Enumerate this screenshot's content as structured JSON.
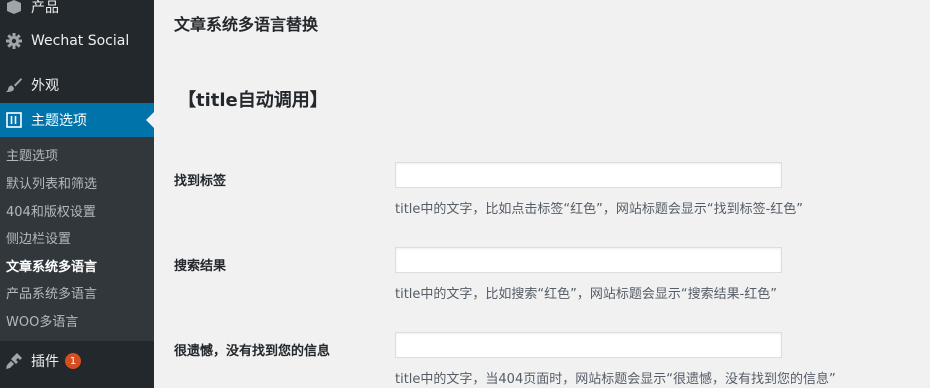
{
  "sidebar": {
    "top": [
      {
        "label": "产品",
        "icon": "archive-icon"
      },
      {
        "label": "Wechat Social",
        "icon": "gear-icon"
      },
      {
        "label": "外观",
        "icon": "paintbrush-icon"
      },
      {
        "label": "主题选项",
        "icon": "theme-options-icon",
        "current": true
      }
    ],
    "submenu": [
      {
        "label": "主题选项"
      },
      {
        "label": "默认列表和筛选"
      },
      {
        "label": "404和版权设置"
      },
      {
        "label": "侧边栏设置"
      },
      {
        "label": "文章系统多语言",
        "active": true
      },
      {
        "label": "产品系统多语言"
      },
      {
        "label": "WOO多语言"
      }
    ],
    "plugins": {
      "label": "插件",
      "badge": "1",
      "icon": "plugin-icon"
    }
  },
  "main": {
    "page_title": "文章系统多语言替换",
    "section_title": "【title自动调用】",
    "fields": [
      {
        "label": "找到标签",
        "value": "",
        "description": "title中的文字，比如点击标签“红色”，网站标题会显示“找到标签-红色”"
      },
      {
        "label": "搜索结果",
        "value": "",
        "description": "title中的文字，比如搜索“红色”，网站标题会显示“搜索结果-红色”"
      },
      {
        "label": "很遗憾，没有找到您的信息",
        "value": "",
        "description": "title中的文字，当404页面时，网站标题会显示“很遗憾，没有找到您的信息”"
      }
    ]
  },
  "colors": {
    "sidebar_bg": "#23282d",
    "submenu_bg": "#32373c",
    "accent": "#0073aa",
    "badge": "#d54e21",
    "page_bg": "#f1f1f1"
  }
}
